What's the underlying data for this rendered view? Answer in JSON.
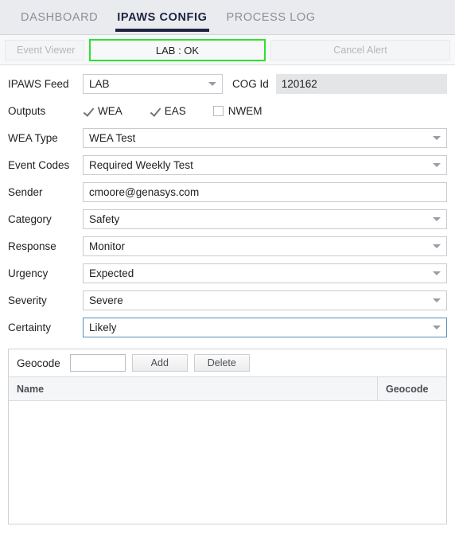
{
  "tabs": [
    {
      "label": "DASHBOARD",
      "active": false
    },
    {
      "label": "IPAWS CONFIG",
      "active": true
    },
    {
      "label": "PROCESS LOG",
      "active": false
    }
  ],
  "actions": {
    "event_viewer": "Event Viewer",
    "status": "LAB : OK",
    "cancel_alert": "Cancel Alert",
    "status_border_color": "#2ee02e"
  },
  "form": {
    "ipaws_feed": {
      "label": "IPAWS Feed",
      "value": "LAB"
    },
    "cog_id": {
      "label": "COG Id",
      "value": "120162"
    },
    "outputs": {
      "label": "Outputs",
      "items": [
        {
          "label": "WEA",
          "checked": true
        },
        {
          "label": "EAS",
          "checked": true
        },
        {
          "label": "NWEM",
          "checked": false
        }
      ]
    },
    "rows": [
      {
        "label": "WEA Type",
        "value": "WEA Test",
        "type": "select",
        "focused": false
      },
      {
        "label": "Event Codes",
        "value": "Required Weekly Test",
        "type": "select",
        "focused": false
      },
      {
        "label": "Sender",
        "value": "cmoore@genasys.com",
        "type": "text",
        "focused": false
      },
      {
        "label": "Category",
        "value": "Safety",
        "type": "select",
        "focused": false
      },
      {
        "label": "Response",
        "value": "Monitor",
        "type": "select",
        "focused": false
      },
      {
        "label": "Urgency",
        "value": "Expected",
        "type": "select",
        "focused": false
      },
      {
        "label": "Severity",
        "value": "Severe",
        "type": "select",
        "focused": false
      },
      {
        "label": "Certainty",
        "value": "Likely",
        "type": "select",
        "focused": true
      }
    ]
  },
  "geocode": {
    "label": "Geocode",
    "input_value": "",
    "add_label": "Add",
    "delete_label": "Delete",
    "columns": [
      "Name",
      "Geocode"
    ],
    "rows": []
  }
}
